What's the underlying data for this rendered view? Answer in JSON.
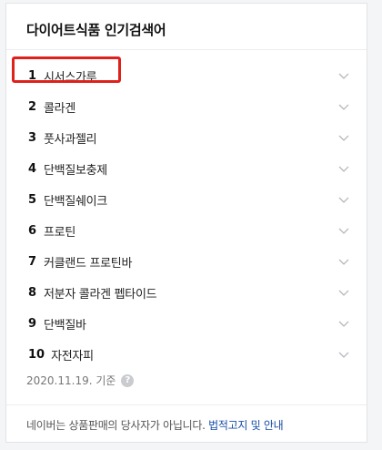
{
  "panel": {
    "title": "다이어트식품 인기검색어",
    "items": [
      {
        "rank": "1",
        "term": "시서스가루"
      },
      {
        "rank": "2",
        "term": "콜라겐"
      },
      {
        "rank": "3",
        "term": "풋사과젤리"
      },
      {
        "rank": "4",
        "term": "단백질보충제"
      },
      {
        "rank": "5",
        "term": "단백질쉐이크"
      },
      {
        "rank": "6",
        "term": "프로틴"
      },
      {
        "rank": "7",
        "term": "커클랜드 프로틴바"
      },
      {
        "rank": "8",
        "term": "저분자 콜라겐 펩타이드"
      },
      {
        "rank": "9",
        "term": "단백질바"
      },
      {
        "rank": "10",
        "term": "자전자피"
      }
    ],
    "date_text": "2020.11.19. 기준",
    "help_glyph": "?"
  },
  "footer": {
    "text": "네이버는 상품판매의 당사자가 아닙니다.",
    "link_legal": "법적고지",
    "and_text": "및",
    "link_guide": "안내"
  },
  "colors": {
    "highlight": "#e0201b",
    "link": "#1a4fa8"
  }
}
